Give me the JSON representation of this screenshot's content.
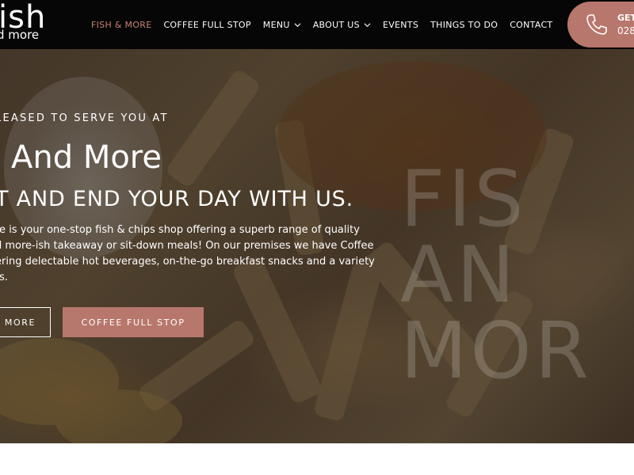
{
  "brand": {
    "logo_main": "ish",
    "logo_sub": "d more"
  },
  "nav": {
    "items": [
      {
        "label": "FISH & MORE",
        "active": true,
        "has_dropdown": false
      },
      {
        "label": "COFFEE FULL STOP",
        "active": false,
        "has_dropdown": false
      },
      {
        "label": "MENU",
        "active": false,
        "has_dropdown": true
      },
      {
        "label": "ABOUT US",
        "active": false,
        "has_dropdown": true
      },
      {
        "label": "EVENTS",
        "active": false,
        "has_dropdown": false
      },
      {
        "label": "THINGS TO DO",
        "active": false,
        "has_dropdown": false
      },
      {
        "label": "CONTACT",
        "active": false,
        "has_dropdown": false
      }
    ]
  },
  "cta": {
    "label": "GET",
    "phone": "028",
    "icon": "phone-icon"
  },
  "hero": {
    "eyebrow": "LEASED TO SERVE YOU AT",
    "title": "And More",
    "subtitle": "T AND END YOUR DAY WITH US.",
    "body_lines": [
      "re is your one-stop fish & chips shop offering a superb range of quality",
      "d more-ish takeaway or sit-down meals! On our premises we have Coffee",
      "ering delectable hot beverages, on-the-go breakfast snacks and a variety",
      "ts."
    ],
    "buttons": {
      "primary": "D MORE",
      "secondary": "COFFEE FULL STOP"
    },
    "watermark_lines": [
      "FIS",
      "AN",
      "MOR"
    ]
  },
  "colors": {
    "header_bg": "#060606",
    "accent": "#b8776d",
    "nav_active": "#c98172",
    "text_light": "#ffffff"
  }
}
